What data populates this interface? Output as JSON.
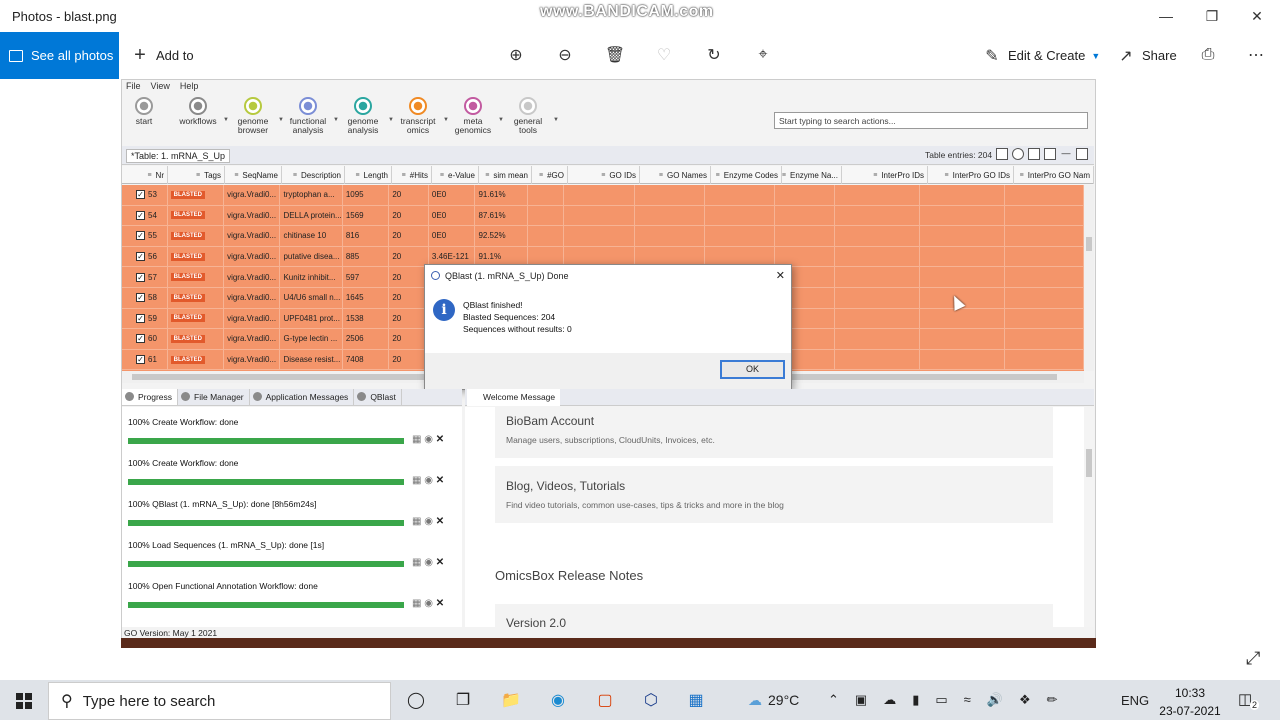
{
  "window": {
    "title": "Photos - blast.png",
    "watermark": "www.BANDICAM.com"
  },
  "photos_toolbar": {
    "see_all": "See all photos",
    "add_to": "Add to",
    "edit_create": "Edit & Create",
    "share": "Share"
  },
  "menu": [
    "File",
    "View",
    "Help"
  ],
  "ribbon": [
    {
      "label1": "start",
      "label2": "",
      "color": "#9a9a9a"
    },
    {
      "label1": "",
      "label2": "workflows",
      "color": "#8a8a8a"
    },
    {
      "label1": "genome",
      "label2": "browser",
      "color": "#b6c93e"
    },
    {
      "label1": "functional",
      "label2": "analysis",
      "color": "#7b8ed6"
    },
    {
      "label1": "genome",
      "label2": "analysis",
      "color": "#2aa6a0"
    },
    {
      "label1": "transcript",
      "label2": "omics",
      "color": "#f08a24"
    },
    {
      "label1": "meta",
      "label2": "genomics",
      "color": "#c25aa0"
    },
    {
      "label1": "general",
      "label2": "tools",
      "color": "#c8c8c8"
    }
  ],
  "search_actions": {
    "placeholder": "Start typing to search actions..."
  },
  "table": {
    "tab_label": "*Table: 1. mRNA_S_Up",
    "entries": "Table entries: 204",
    "columns": [
      "Nr",
      "Tags",
      "SeqName",
      "Description",
      "Length",
      "#Hits",
      "e-Value",
      "sim mean",
      "#GO",
      "GO IDs",
      "GO Names",
      "Enzyme Codes",
      "Enzyme Na...",
      "InterPro IDs",
      "InterPro GO IDs",
      "InterPro GO Nam"
    ],
    "rows": [
      {
        "nr": "53",
        "tag": "BLASTED",
        "seq": "vigra.Vradi0...",
        "desc": "tryptophan a...",
        "len": "1095",
        "hits": "20",
        "eval": "0E0",
        "sim": "91.61%"
      },
      {
        "nr": "54",
        "tag": "BLASTED",
        "seq": "vigra.Vradi0...",
        "desc": "DELLA protein...",
        "len": "1569",
        "hits": "20",
        "eval": "0E0",
        "sim": "87.61%"
      },
      {
        "nr": "55",
        "tag": "BLASTED",
        "seq": "vigra.Vradi0...",
        "desc": "chitinase 10",
        "len": "816",
        "hits": "20",
        "eval": "0E0",
        "sim": "92.52%"
      },
      {
        "nr": "56",
        "tag": "BLASTED",
        "seq": "vigra.Vradi0...",
        "desc": "putative disea...",
        "len": "885",
        "hits": "20",
        "eval": "3.46E-121",
        "sim": "91.1%"
      },
      {
        "nr": "57",
        "tag": "BLASTED",
        "seq": "vigra.Vradi0...",
        "desc": "Kunitz inhibit...",
        "len": "597",
        "hits": "20",
        "eval": "",
        "sim": ""
      },
      {
        "nr": "58",
        "tag": "BLASTED",
        "seq": "vigra.Vradi0...",
        "desc": "U4/U6 small n...",
        "len": "1645",
        "hits": "20",
        "eval": "",
        "sim": ""
      },
      {
        "nr": "59",
        "tag": "BLASTED",
        "seq": "vigra.Vradi0...",
        "desc": "UPF0481 prot...",
        "len": "1538",
        "hits": "20",
        "eval": "",
        "sim": ""
      },
      {
        "nr": "60",
        "tag": "BLASTED",
        "seq": "vigra.Vradi0...",
        "desc": "G-type lectin ...",
        "len": "2506",
        "hits": "20",
        "eval": "",
        "sim": ""
      },
      {
        "nr": "61",
        "tag": "BLASTED",
        "seq": "vigra.Vradi0...",
        "desc": "Disease resist...",
        "len": "7408",
        "hits": "20",
        "eval": "",
        "sim": ""
      }
    ]
  },
  "dialog": {
    "title": "QBlast (1. mRNA_S_Up) Done",
    "line1": "QBlast finished!",
    "line2": "Blasted Sequences: 204",
    "line3": "Sequences without results: 0",
    "ok": "OK"
  },
  "progress": {
    "tabs": [
      "Progress",
      "File Manager",
      "Application Messages",
      "QBlast"
    ],
    "items": [
      {
        "text": "100%  Create Workflow: done",
        "value": 1
      },
      {
        "text": "100%  Create Workflow: done",
        "value": 1
      },
      {
        "text": "100%  QBlast (1. mRNA_S_Up): done [8h56m24s]",
        "value": 1
      },
      {
        "text": "100%  Load Sequences (1. mRNA_S_Up): done [1s]",
        "value": 1
      },
      {
        "text": "100%  Open Functional Annotation Workflow: done",
        "value": 1
      }
    ]
  },
  "welcome": {
    "tab": "Welcome Message",
    "card1_title": "BioBam Account",
    "card1_sub": "Manage users, subscriptions, CloudUnits, Invoices, etc.",
    "card2_title": "Blog, Videos, Tutorials",
    "card2_sub": "Find video tutorials, common use-cases, tips & tricks and more in the blog",
    "section": "OmicsBox Release Notes",
    "version": "Version 2.0"
  },
  "status": "GO Version: May 1 2021",
  "taskbar": {
    "search": "Type here to search",
    "temp": "29°C",
    "lang": "ENG",
    "time": "10:33",
    "date": "23-07-2021",
    "notif": "2"
  }
}
